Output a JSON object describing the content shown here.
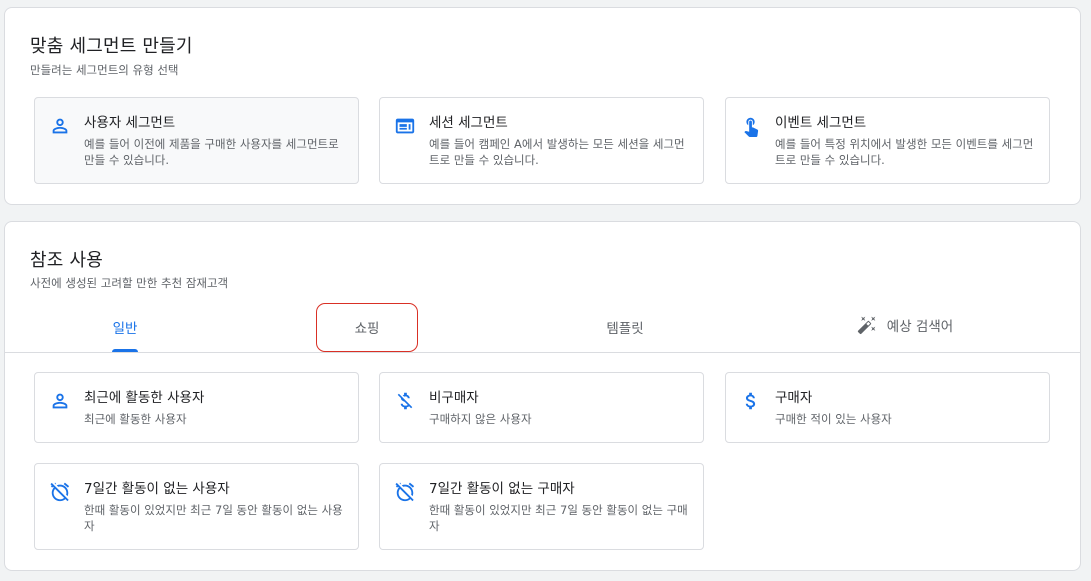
{
  "create_section": {
    "title": "맞춤 세그먼트 만들기",
    "subtitle": "만들려는 세그먼트의 유형 선택",
    "cards": [
      {
        "title": "사용자 세그먼트",
        "description": "예를 들어 이전에 제품을 구매한 사용자를 세그먼트로 만들 수 있습니다.",
        "icon": "person-icon"
      },
      {
        "title": "세션 세그먼트",
        "description": "예를 들어 캠페인 A에서 발생하는 모든 세션을 세그먼트로 만들 수 있습니다.",
        "icon": "session-window-icon"
      },
      {
        "title": "이벤트 세그먼트",
        "description": "예를 들어 특정 위치에서 발생한 모든 이벤트를 세그먼트로 만들 수 있습니다.",
        "icon": "touch-hand-icon"
      }
    ]
  },
  "reference_section": {
    "title": "참조 사용",
    "subtitle": "사전에 생성된 고려할 만한 추천 잠재고객",
    "tabs": [
      {
        "label": "일반",
        "active": true
      },
      {
        "label": "쇼핑",
        "active": false
      },
      {
        "label": "템플릿",
        "active": false
      },
      {
        "label": "예상 검색어",
        "active": false,
        "icon": "magic-wand-icon"
      }
    ],
    "cards": [
      {
        "title": "최근에 활동한 사용자",
        "description": "최근에 활동한 사용자",
        "icon": "person-icon"
      },
      {
        "title": "비구매자",
        "description": "구매하지 않은 사용자",
        "icon": "money-off-icon"
      },
      {
        "title": "구매자",
        "description": "구매한 적이 있는 사용자",
        "icon": "dollar-icon"
      },
      {
        "title": "7일간 활동이 없는 사용자",
        "description": "한때 활동이 있었지만 최근 7일 동안 활동이 없는 사용자",
        "icon": "alarm-off-icon"
      },
      {
        "title": "7일간 활동이 없는 구매자",
        "description": "한때 활동이 있었지만 최근 7일 동안 활동이 없는 구매자",
        "icon": "alarm-off-icon"
      }
    ]
  },
  "colors": {
    "accent": "#1a73e8",
    "highlight": "#d93025"
  }
}
